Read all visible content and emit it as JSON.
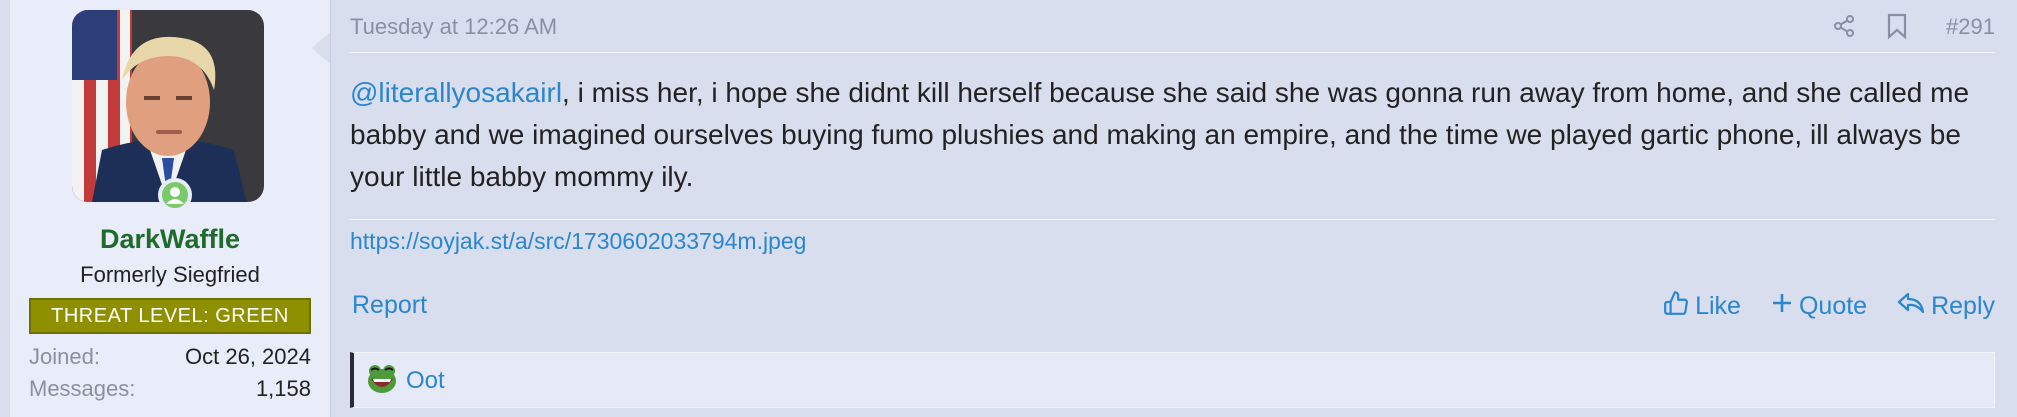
{
  "user": {
    "name": "DarkWaffle",
    "title": "Formerly Siegfried",
    "banner": "THREAT LEVEL: GREEN",
    "joined_label": "Joined:",
    "joined_value": "Oct 26, 2024",
    "messages_label": "Messages:",
    "messages_value": "1,158"
  },
  "post": {
    "date": "Tuesday at 12:26 AM",
    "number": "#291",
    "mention": "@literallyosakairl",
    "body": ", i miss her, i hope she didnt kill herself because she said she was gonna run away from home, and she called me babby and we imagined ourselves buying fumo plushies and making an empire, and the time we played gartic phone, ill always be your little babby mommy ily.",
    "signature_link": "https://soyjak.st/a/src/1730602033794m.jpeg"
  },
  "actions": {
    "report": "Report",
    "like": "Like",
    "quote": "Quote",
    "reply": "Reply"
  },
  "reactions": {
    "user": "Oot"
  },
  "colors": {
    "accent": "#2a86cf",
    "username": "#1f6b2b",
    "banner": "#8f9000",
    "online": "#7cc96b"
  }
}
